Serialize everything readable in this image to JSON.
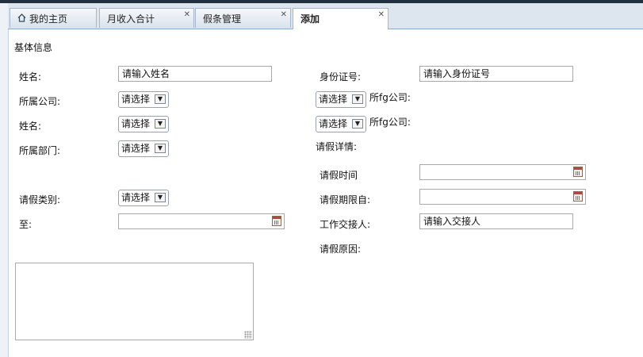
{
  "tabs": [
    {
      "label": "我的主页",
      "closable": false,
      "active": false,
      "icon": "home-icon"
    },
    {
      "label": "月收入合计",
      "closable": true,
      "active": false
    },
    {
      "label": "假条管理",
      "closable": true,
      "active": false
    },
    {
      "label": "添加",
      "closable": true,
      "active": true
    }
  ],
  "section_title": "基体信息",
  "left": {
    "name_label": "姓名:",
    "name_placeholder": "请输入姓名",
    "company_label": "所属公司:",
    "company_value": "请选择",
    "name2_label": "姓名:",
    "name2_value": "请选择",
    "dept_label": "所属部门:",
    "dept_value": "请选择",
    "leave_type_label": "请假类别:",
    "leave_type_value": "请选择",
    "to_label": "至:",
    "to_value": ""
  },
  "right": {
    "id_label": "身份证号:",
    "id_placeholder": "请输入身份证号",
    "company_fg_select": "请选择",
    "company_fg_label": "所fg公司:",
    "company_fg2_select": "请选择",
    "company_fg2_label": "所fg公司:",
    "leave_detail_label": "请假详情:",
    "leave_time_label": "请假时间",
    "leave_start_label": "请假期限自:",
    "handover_label": "工作交接人:",
    "handover_placeholder": "请输入交接人",
    "reason_label": "请假原因:"
  },
  "reason_text": "",
  "colors": {
    "tab_bar": "#dde5ef",
    "top_strip": "#23303f",
    "border": "#a9a9a9"
  }
}
